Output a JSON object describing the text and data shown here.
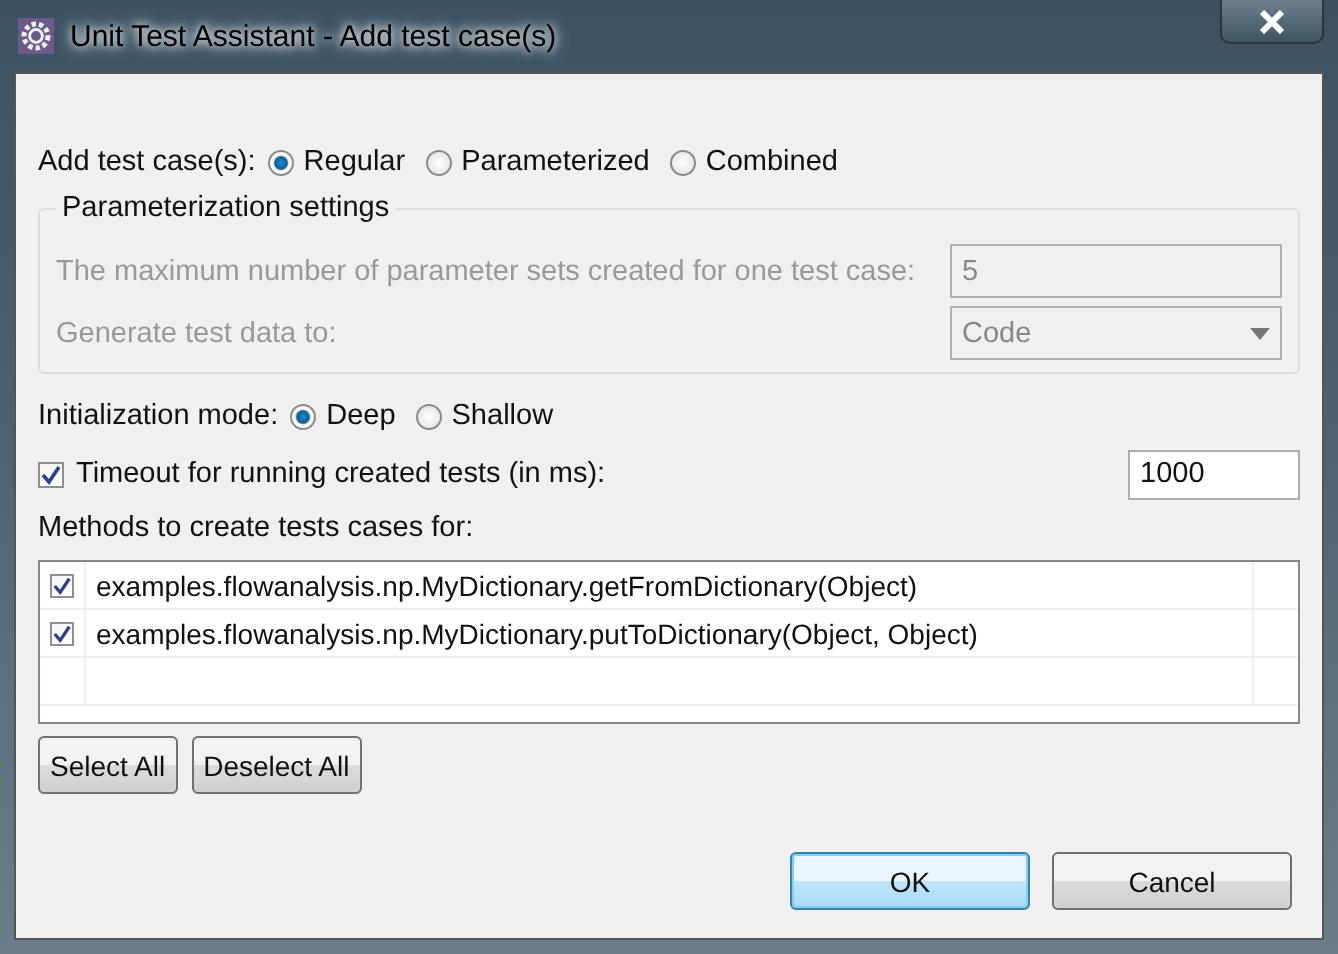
{
  "window": {
    "title": "Unit Test Assistant - Add test case(s)"
  },
  "add_test_cases": {
    "label": "Add test case(s):",
    "options": [
      {
        "label": "Regular",
        "selected": true
      },
      {
        "label": "Parameterized",
        "selected": false
      },
      {
        "label": "Combined",
        "selected": false
      }
    ]
  },
  "parameterization": {
    "title": "Parameterization settings",
    "disabled": true,
    "max_sets": {
      "label": "The maximum number of parameter sets created for one test case:",
      "value": "5"
    },
    "generate_to": {
      "label": "Generate test data to:",
      "value": "Code"
    }
  },
  "initialization": {
    "label": "Initialization mode:",
    "options": [
      {
        "label": "Deep",
        "selected": true
      },
      {
        "label": "Shallow",
        "selected": false
      }
    ]
  },
  "timeout": {
    "label": "Timeout for running created tests (in ms):",
    "checked": true,
    "value": "1000"
  },
  "methods": {
    "label": "Methods to create tests cases for:",
    "items": [
      {
        "label": "examples.flowanalysis.np.MyDictionary.getFromDictionary(Object)",
        "checked": true
      },
      {
        "label": "examples.flowanalysis.np.MyDictionary.putToDictionary(Object, Object)",
        "checked": true
      }
    ]
  },
  "list_buttons": [
    "Select All",
    "Deselect All"
  ],
  "dialog_buttons": [
    {
      "label": "OK",
      "default": true
    },
    {
      "label": "Cancel",
      "default": false
    }
  ]
}
